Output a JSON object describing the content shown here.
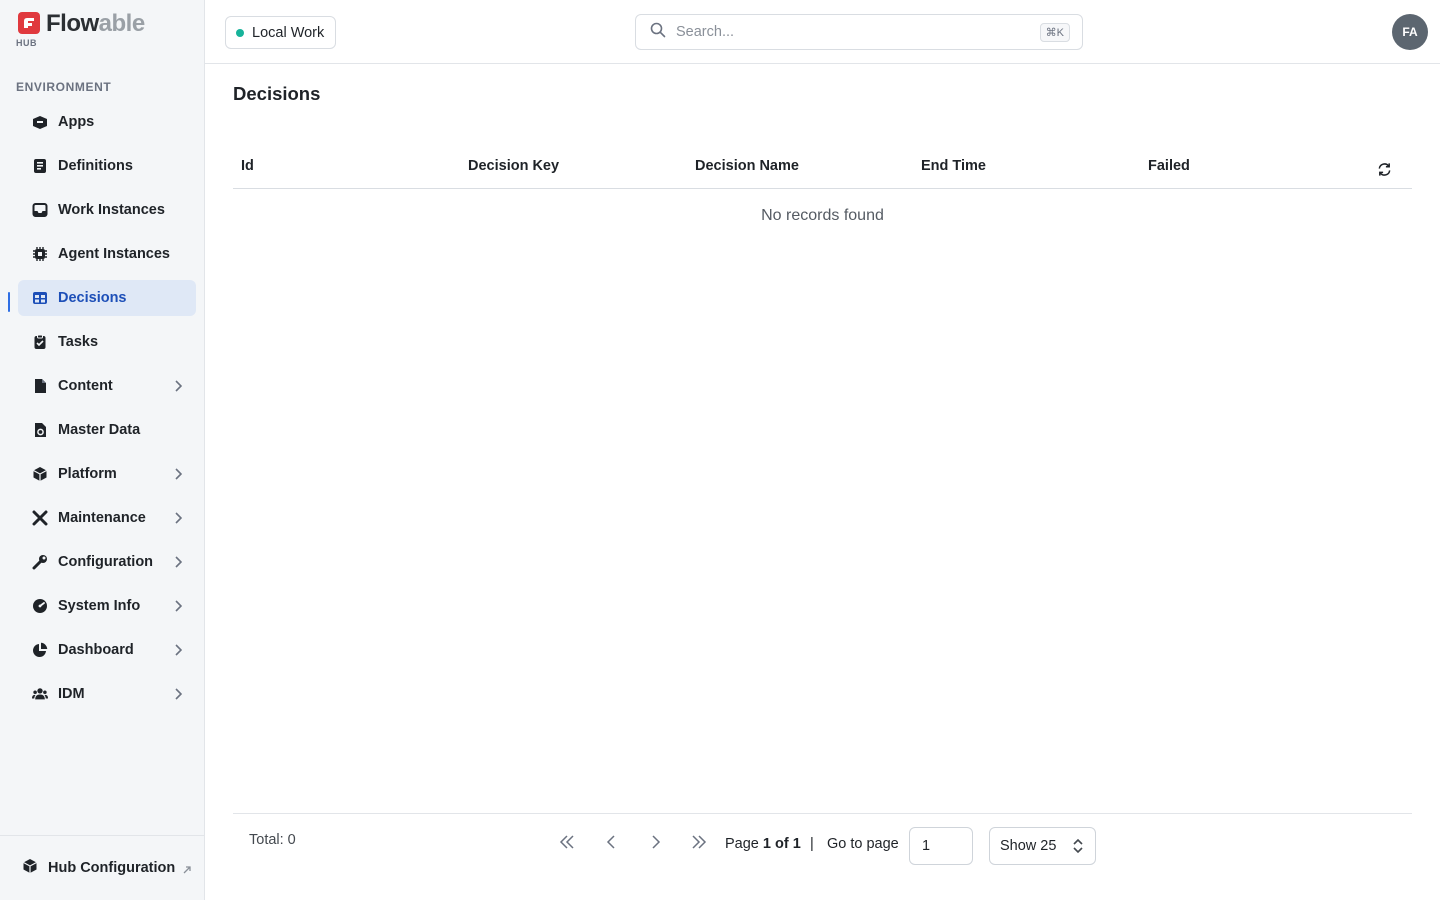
{
  "brand": {
    "name_part1": "Flow",
    "name_part2": "able",
    "sub": "HUB",
    "accent": "#e0393e"
  },
  "sidebar": {
    "section_label": "ENVIRONMENT",
    "items": [
      {
        "label": "Apps",
        "icon": "apps-box-icon",
        "has_children": false,
        "active": false
      },
      {
        "label": "Definitions",
        "icon": "definitions-icon",
        "has_children": false,
        "active": false
      },
      {
        "label": "Work Instances",
        "icon": "inbox-icon",
        "has_children": false,
        "active": false
      },
      {
        "label": "Agent Instances",
        "icon": "chip-icon",
        "has_children": false,
        "active": false
      },
      {
        "label": "Decisions",
        "icon": "table-icon",
        "has_children": false,
        "active": true
      },
      {
        "label": "Tasks",
        "icon": "clipboard-check-icon",
        "has_children": false,
        "active": false
      },
      {
        "label": "Content",
        "icon": "file-icon",
        "has_children": true,
        "active": false
      },
      {
        "label": "Master Data",
        "icon": "file-gear-icon",
        "has_children": false,
        "active": false
      },
      {
        "label": "Platform",
        "icon": "cube-icon",
        "has_children": true,
        "active": false
      },
      {
        "label": "Maintenance",
        "icon": "tools-icon",
        "has_children": true,
        "active": false
      },
      {
        "label": "Configuration",
        "icon": "wrench-icon",
        "has_children": true,
        "active": false
      },
      {
        "label": "System Info",
        "icon": "gauge-icon",
        "has_children": true,
        "active": false
      },
      {
        "label": "Dashboard",
        "icon": "pie-chart-icon",
        "has_children": true,
        "active": false
      },
      {
        "label": "IDM",
        "icon": "users-icon",
        "has_children": true,
        "active": false
      }
    ],
    "footer_label": "Hub Configuration"
  },
  "header": {
    "environment": "Local Work",
    "environment_status_color": "#17b39a",
    "search_placeholder": "Search...",
    "search_shortcut": "⌘K",
    "avatar_initials": "FA"
  },
  "main": {
    "title": "Decisions",
    "columns": [
      "Id",
      "Decision Key",
      "Decision Name",
      "End Time",
      "Failed"
    ],
    "rows": [],
    "empty_text": "No records found"
  },
  "pagination": {
    "total_text": "Total: 0",
    "page_prefix": "Page",
    "page_value": "1 of 1",
    "separator": "|",
    "goto_label": "Go to page",
    "goto_value": "1",
    "show_label": "Show 25"
  }
}
